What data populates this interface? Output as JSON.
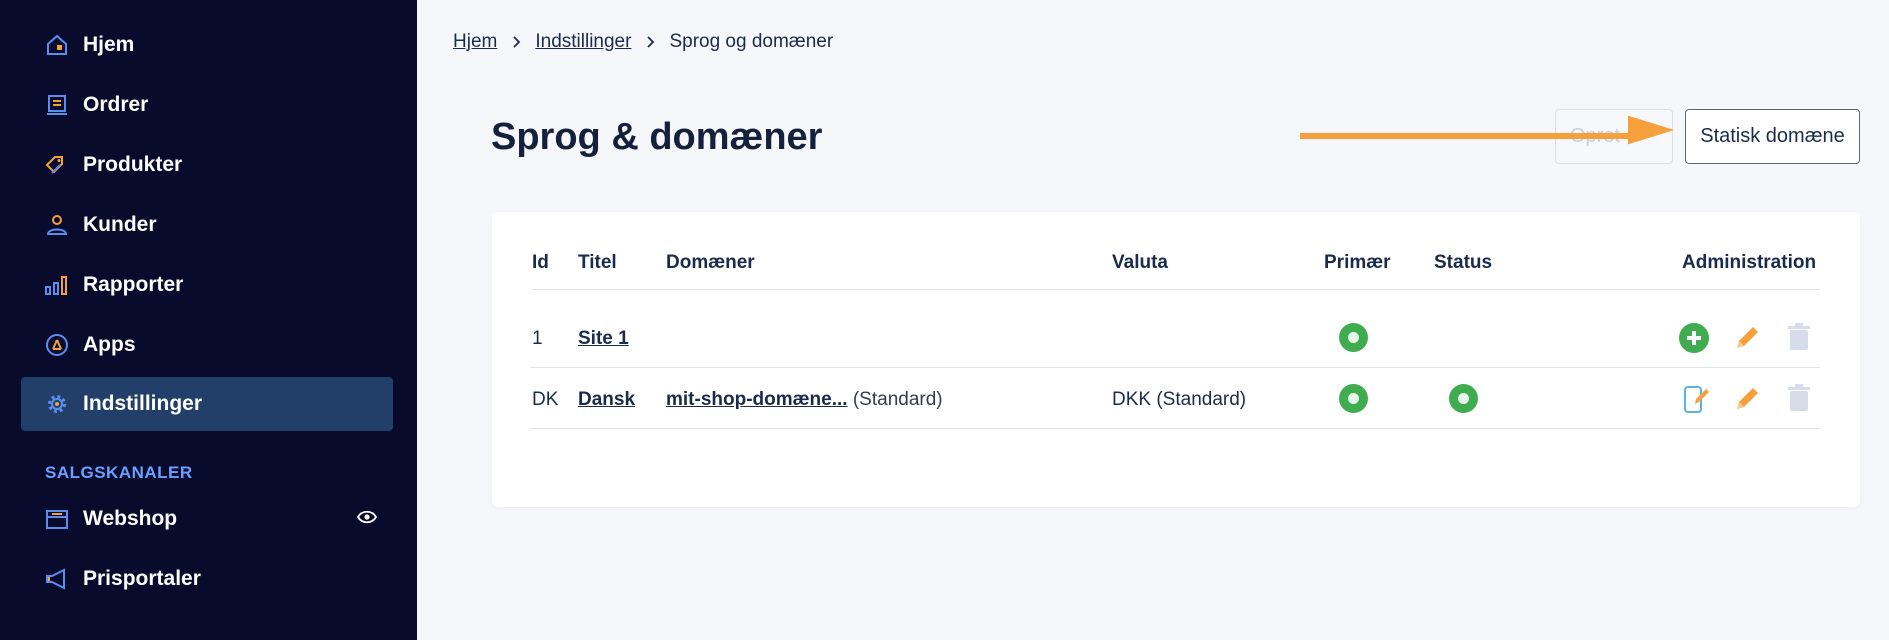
{
  "sidebar": {
    "items": [
      {
        "label": "Hjem",
        "icon": "home-icon"
      },
      {
        "label": "Ordrer",
        "icon": "orders-icon"
      },
      {
        "label": "Produkter",
        "icon": "tag-icon"
      },
      {
        "label": "Kunder",
        "icon": "user-icon"
      },
      {
        "label": "Rapporter",
        "icon": "bar-chart-icon"
      },
      {
        "label": "Apps",
        "icon": "apps-icon"
      },
      {
        "label": "Indstillinger",
        "icon": "gear-icon",
        "active": true
      }
    ],
    "section_title": "SALGSKANALER",
    "channels": [
      {
        "label": "Webshop",
        "icon": "store-icon"
      },
      {
        "label": "Prisportaler",
        "icon": "megaphone-icon"
      }
    ]
  },
  "breadcrumb": [
    "Hjem",
    "Indstillinger",
    "Sprog og domæner"
  ],
  "page": {
    "title": "Sprog & domæner",
    "create_button": "Opret",
    "static_domain_button": "Statisk domæne"
  },
  "table": {
    "columns": [
      "Id",
      "Titel",
      "Domæner",
      "Valuta",
      "Primær",
      "Status",
      "Administration"
    ],
    "rows": [
      {
        "id": "1",
        "title": "Site 1",
        "domain": "",
        "domain_note": "",
        "currency": "",
        "primary": true,
        "status": false,
        "actions": [
          "add-icon",
          "edit-icon",
          "delete-icon"
        ]
      },
      {
        "id": "DK",
        "title": "Dansk",
        "domain": "mit-shop-domæne...",
        "domain_note": "(Standard)",
        "currency": "DKK (Standard)",
        "primary": true,
        "status": true,
        "actions": [
          "translate-icon",
          "edit-icon",
          "delete-icon"
        ]
      }
    ]
  },
  "colors": {
    "sidebar_bg": "#080b2c",
    "active_bg": "#213f69",
    "accent_orange": "#f5a03a",
    "icon_blue": "#5b8def",
    "status_green": "#3fac4f",
    "text_dark": "#1a2b4c"
  }
}
